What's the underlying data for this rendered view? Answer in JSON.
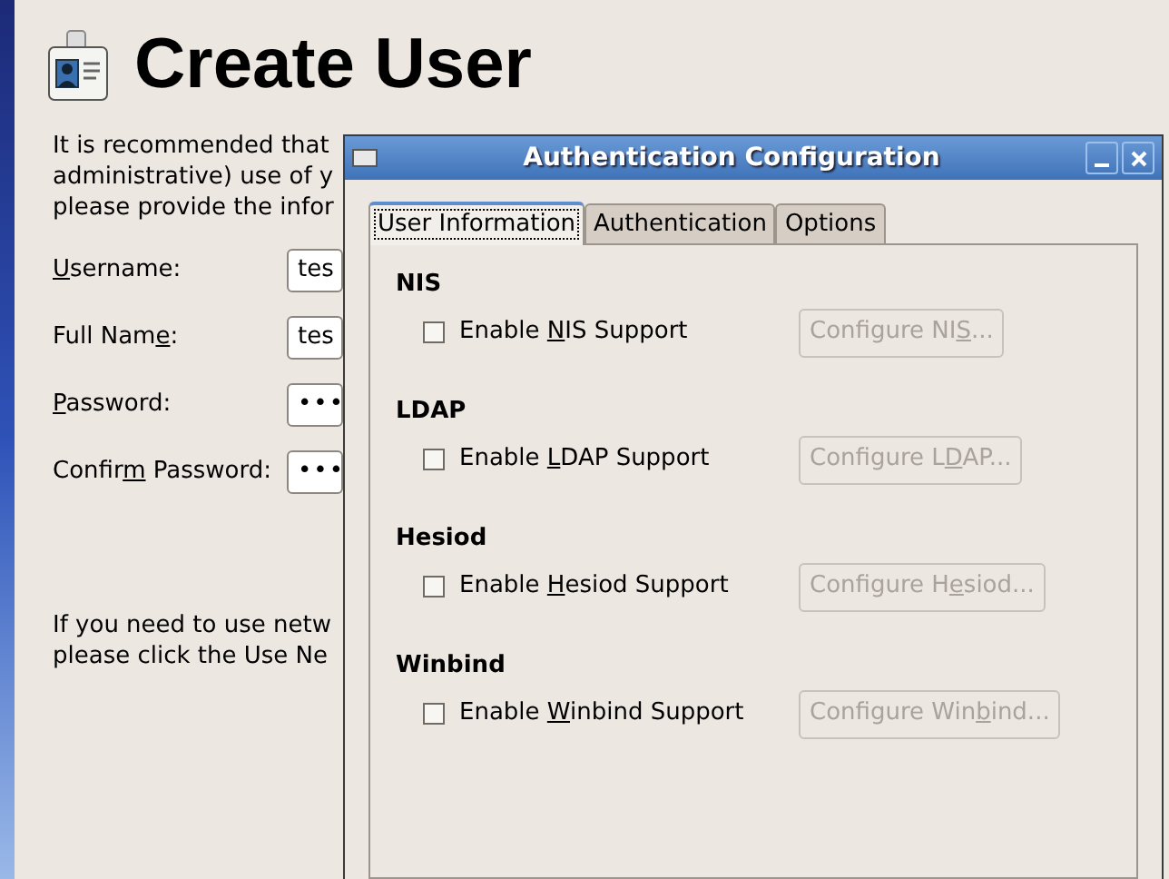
{
  "page": {
    "title": "Create User",
    "intro_lines": [
      "It is recommended that",
      "administrative) use of y",
      "please provide the infor"
    ],
    "fields": [
      {
        "label": {
          "key": "U",
          "after": "sername:"
        },
        "kind": "text",
        "value": "tes"
      },
      {
        "label": {
          "before": "Full Nam",
          "key": "e",
          "after": ":"
        },
        "kind": "text",
        "value": "tes"
      },
      {
        "label": {
          "key": "P",
          "after": "assword:"
        },
        "kind": "password",
        "value": "•••"
      },
      {
        "label": {
          "before": "Confir",
          "key": "m",
          "after": " Password:"
        },
        "kind": "password",
        "value": "•••"
      }
    ],
    "network_lines": [
      "If you need to use netw",
      "please click the Use Ne"
    ]
  },
  "dialog": {
    "title": "Authentication Configuration",
    "tabs": [
      {
        "label": "User Information",
        "selected": true
      },
      {
        "label": "Authentication",
        "selected": false
      },
      {
        "label": "Options",
        "selected": false
      }
    ],
    "sections": [
      {
        "heading": "NIS",
        "checkbox": {
          "before": "Enable ",
          "key": "N",
          "after": "IS Support"
        },
        "checked": false,
        "button": {
          "before": "Configure NI",
          "key": "S",
          "after": "..."
        },
        "disabled": true
      },
      {
        "heading": "LDAP",
        "checkbox": {
          "before": "Enable ",
          "key": "L",
          "after": "DAP Support"
        },
        "checked": false,
        "button": {
          "before": "Configure L",
          "key": "D",
          "after": "AP..."
        },
        "disabled": true
      },
      {
        "heading": "Hesiod",
        "checkbox": {
          "before": "Enable ",
          "key": "H",
          "after": "esiod Support"
        },
        "checked": false,
        "button": {
          "before": "Configure H",
          "key": "e",
          "after": "siod..."
        },
        "disabled": true
      },
      {
        "heading": "Winbind",
        "checkbox": {
          "before": "Enable ",
          "key": "W",
          "after": "inbind Support"
        },
        "checked": false,
        "button": {
          "before": "Configure Win",
          "key": "b",
          "after": "ind..."
        },
        "disabled": true
      }
    ]
  }
}
